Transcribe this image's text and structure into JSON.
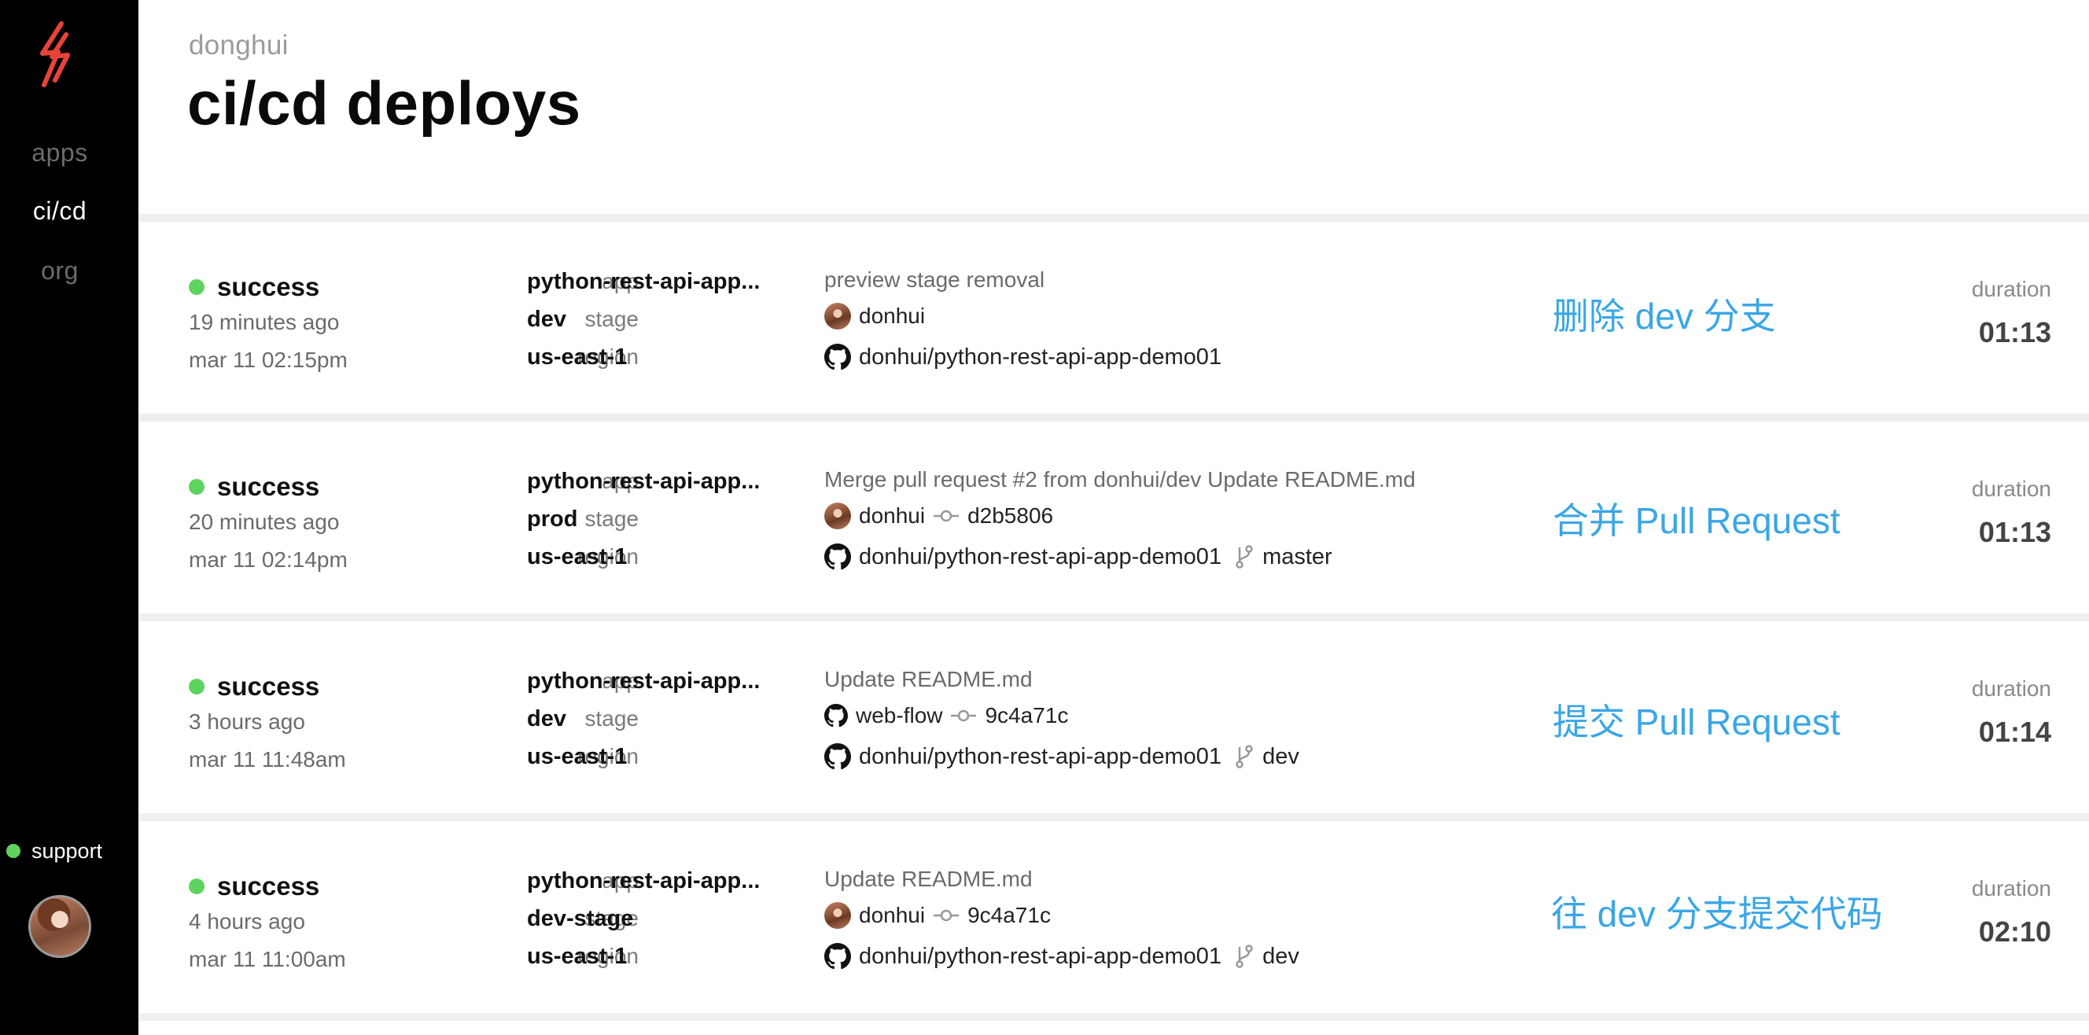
{
  "sidebar": {
    "nav": [
      {
        "label": "apps",
        "active": false
      },
      {
        "label": "ci/cd",
        "active": true
      },
      {
        "label": "org",
        "active": false
      }
    ],
    "support_label": "support",
    "status_color": "#5fd35f",
    "logo_color": "#e8433a"
  },
  "header": {
    "owner": "donghui",
    "title": "ci/cd deploys"
  },
  "labels": {
    "app": "app",
    "stage": "stage",
    "region": "region",
    "duration": "duration"
  },
  "deploys": [
    {
      "status": "success",
      "ago": "19 minutes ago",
      "date": "mar 11 02:15pm",
      "app": "python-rest-api-app...",
      "stage": "dev",
      "region": "us-east-1",
      "commit_message": "preview stage removal",
      "author": "donhui",
      "author_icon": "user-avatar",
      "commit": "",
      "repo": "donhui/python-rest-api-app-demo01",
      "branch": "",
      "note": "删除 dev 分支",
      "duration": "01:13"
    },
    {
      "status": "success",
      "ago": "20 minutes ago",
      "date": "mar 11 02:14pm",
      "app": "python-rest-api-app...",
      "stage": "prod",
      "region": "us-east-1",
      "commit_message": "Merge pull request #2 from donhui/dev Update README.md",
      "author": "donhui",
      "author_icon": "user-avatar",
      "commit": "d2b5806",
      "repo": "donhui/python-rest-api-app-demo01",
      "branch": "master",
      "note": "合并 Pull Request",
      "duration": "01:13"
    },
    {
      "status": "success",
      "ago": "3 hours ago",
      "date": "mar 11 11:48am",
      "app": "python-rest-api-app...",
      "stage": "dev",
      "region": "us-east-1",
      "commit_message": "Update README.md",
      "author": "web-flow",
      "author_icon": "github-icon",
      "commit": "9c4a71c",
      "repo": "donhui/python-rest-api-app-demo01",
      "branch": "dev",
      "note": "提交 Pull Request",
      "duration": "01:14"
    },
    {
      "status": "success",
      "ago": "4 hours ago",
      "date": "mar 11 11:00am",
      "app": "python-rest-api-app...",
      "stage": "dev-stage",
      "region": "us-east-1",
      "commit_message": "Update README.md",
      "author": "donhui",
      "author_icon": "user-avatar",
      "commit": "9c4a71c",
      "repo": "donhui/python-rest-api-app-demo01",
      "branch": "dev",
      "note": "往 dev 分支提交代码",
      "duration": "02:10"
    }
  ]
}
